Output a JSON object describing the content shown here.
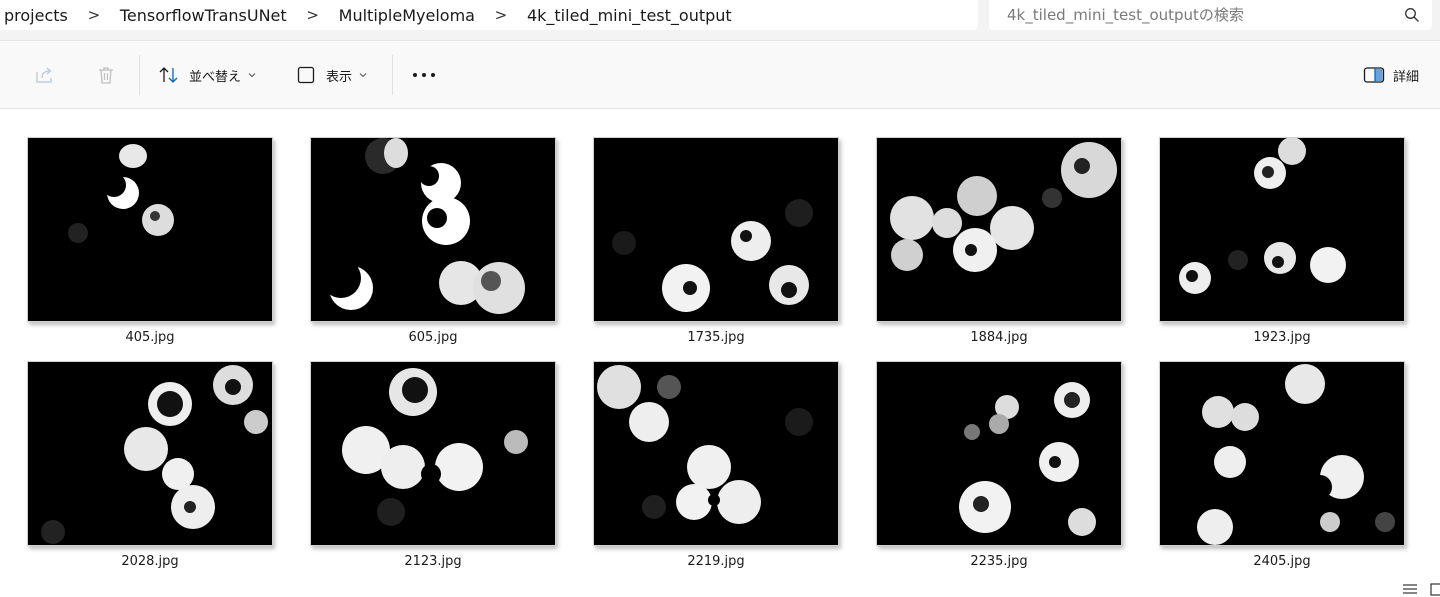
{
  "breadcrumb": {
    "items": [
      "projects",
      "TensorflowTransUNet",
      "MultipleMyeloma",
      "4k_tiled_mini_test_output"
    ],
    "separator": ">"
  },
  "search": {
    "placeholder": "4k_tiled_mini_test_outputの検索"
  },
  "toolbar": {
    "sort_label": "並べ替え",
    "view_label": "表示",
    "details_label": "詳細",
    "share_icon": "share-icon",
    "delete_icon": "trash-icon",
    "sort_icon": "sort-arrows-icon",
    "view_icon": "view-square-icon",
    "more_icon": "more-dots-icon",
    "details_icon": "details-pane-icon"
  },
  "files": [
    {
      "name": "405.jpg"
    },
    {
      "name": "605.jpg"
    },
    {
      "name": "1735.jpg"
    },
    {
      "name": "1884.jpg"
    },
    {
      "name": "1923.jpg"
    },
    {
      "name": "2028.jpg"
    },
    {
      "name": "2123.jpg"
    },
    {
      "name": "2219.jpg"
    },
    {
      "name": "2235.jpg"
    },
    {
      "name": "2405.jpg"
    }
  ],
  "colors": {
    "accent": "#0067c0",
    "toolbar_bg": "#f9f9f9",
    "thumbnail_bg": "#000000"
  }
}
